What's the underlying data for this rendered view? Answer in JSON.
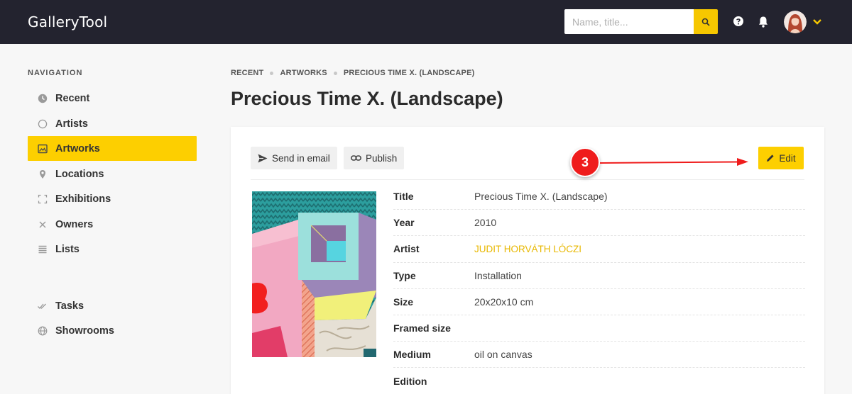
{
  "app": {
    "title": "GalleryTool"
  },
  "search": {
    "placeholder": "Name, title..."
  },
  "colors": {
    "accent": "#fdcf00",
    "topbar": "#23232f",
    "link": "#e8b800",
    "annotation": "#ef1c1c"
  },
  "sidebar": {
    "heading": "NAVIGATION",
    "items": [
      {
        "label": "Recent",
        "icon": "clock-icon"
      },
      {
        "label": "Artists",
        "icon": "circle-icon"
      },
      {
        "label": "Artworks",
        "icon": "image-icon",
        "active": true
      },
      {
        "label": "Locations",
        "icon": "location-pin-icon"
      },
      {
        "label": "Exhibitions",
        "icon": "frame-corners-icon"
      },
      {
        "label": "Owners",
        "icon": "cross-icon"
      },
      {
        "label": "Lists",
        "icon": "list-icon"
      },
      {
        "label": "Tasks",
        "icon": "double-check-icon"
      },
      {
        "label": "Showrooms",
        "icon": "globe-icon"
      }
    ]
  },
  "breadcrumb": [
    "RECENT",
    "ARTWORKS",
    "PRECIOUS TIME X. (LANDSCAPE)"
  ],
  "page": {
    "title": "Precious Time X. (Landscape)"
  },
  "toolbar": {
    "send_label": "Send in email",
    "publish_label": "Publish",
    "edit_label": "Edit"
  },
  "details": [
    {
      "key": "Title",
      "value": "Precious Time X. (Landscape)"
    },
    {
      "key": "Year",
      "value": "2010"
    },
    {
      "key": "Artist",
      "value": "JUDIT HORVÁTH LÓCZI",
      "link": true
    },
    {
      "key": "Type",
      "value": "Installation"
    },
    {
      "key": "Size",
      "value": "20x20x10 cm"
    },
    {
      "key": "Framed size",
      "value": ""
    },
    {
      "key": "Medium",
      "value": "oil on canvas"
    },
    {
      "key": "Edition",
      "value": ""
    }
  ],
  "annotation": {
    "step": "3"
  }
}
